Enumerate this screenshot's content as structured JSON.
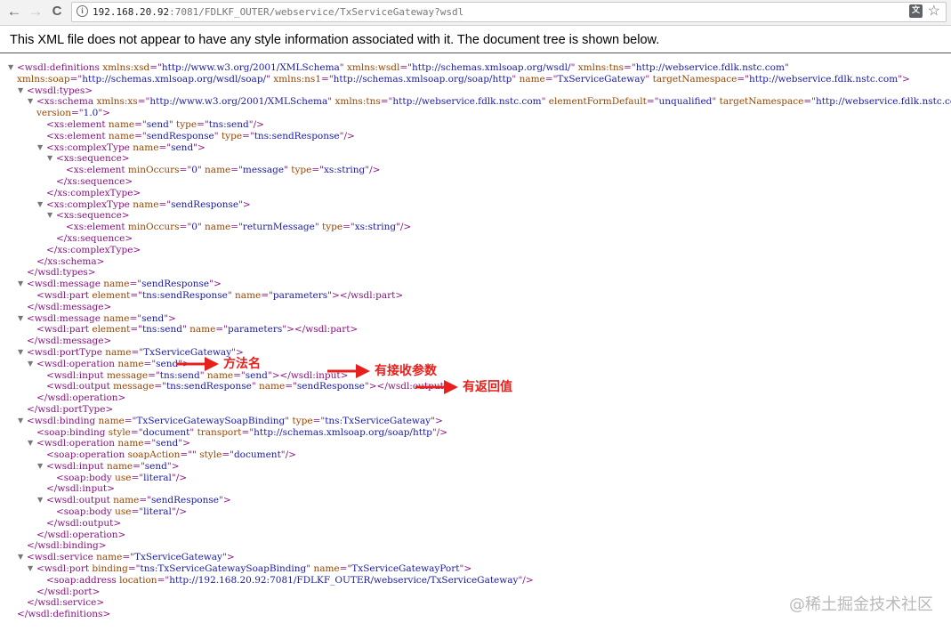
{
  "browser": {
    "url_host": "192.168.20.92",
    "url_rest": ":7081/FDLKF_OUTER/webservice/TxServiceGateway?wsdl",
    "back_glyph": "←",
    "forward_glyph": "→",
    "reload_glyph": "C",
    "info_glyph": "i",
    "translate_glyph": "文",
    "star_glyph": "☆",
    "icons": [
      "back-icon",
      "forward-icon",
      "reload-icon",
      "info-icon",
      "translate-icon",
      "star-icon"
    ]
  },
  "banner": {
    "text": "This XML file does not appear to have any style information associated with it. The document tree is shown below."
  },
  "xml_lines": [
    {
      "fold": true,
      "p": [
        [
          "tag",
          "<wsdl:definitions "
        ],
        [
          "an",
          "xmlns:xsd"
        ],
        [
          "tag",
          "=\""
        ],
        [
          "av",
          "http://www.w3.org/2001/XMLSchema"
        ],
        [
          "tag",
          "\" "
        ],
        [
          "an",
          "xmlns:wsdl"
        ],
        [
          "tag",
          "=\""
        ],
        [
          "av",
          "http://schemas.xmlsoap.org/wsdl/"
        ],
        [
          "tag",
          "\" "
        ],
        [
          "an",
          "xmlns:tns"
        ],
        [
          "tag",
          "=\""
        ],
        [
          "av",
          "http://webservice.fdlk.nstc.com"
        ],
        [
          "tag",
          "\""
        ]
      ]
    },
    {
      "p": [
        [
          "an",
          "xmlns:soap"
        ],
        [
          "tag",
          "=\""
        ],
        [
          "av",
          "http://schemas.xmlsoap.org/wsdl/soap/"
        ],
        [
          "tag",
          "\" "
        ],
        [
          "an",
          "xmlns:ns1"
        ],
        [
          "tag",
          "=\""
        ],
        [
          "av",
          "http://schemas.xmlsoap.org/soap/http"
        ],
        [
          "tag",
          "\" "
        ],
        [
          "an",
          "name"
        ],
        [
          "tag",
          "=\""
        ],
        [
          "av",
          "TxServiceGateway"
        ],
        [
          "tag",
          "\" "
        ],
        [
          "an",
          "targetNamespace"
        ],
        [
          "tag",
          "=\""
        ],
        [
          "av",
          "http://webservice.fdlk.nstc.com"
        ],
        [
          "tag",
          "\">"
        ]
      ]
    },
    {
      "fold": true,
      "p": [
        [
          "tag",
          "<wsdl:types>"
        ]
      ]
    },
    {
      "fold": true,
      "p": [
        [
          "tag",
          "<xs:schema "
        ],
        [
          "an",
          "xmlns:xs"
        ],
        [
          "tag",
          "=\""
        ],
        [
          "av",
          "http://www.w3.org/2001/XMLSchema"
        ],
        [
          "tag",
          "\" "
        ],
        [
          "an",
          "xmlns:tns"
        ],
        [
          "tag",
          "=\""
        ],
        [
          "av",
          "http://webservice.fdlk.nstc.com"
        ],
        [
          "tag",
          "\" "
        ],
        [
          "an",
          "elementFormDefault"
        ],
        [
          "tag",
          "=\""
        ],
        [
          "av",
          "unqualified"
        ],
        [
          "tag",
          "\" "
        ],
        [
          "an",
          "targetNamespace"
        ],
        [
          "tag",
          "=\""
        ],
        [
          "av",
          "http://webservice.fdlk.nstc.com"
        ],
        [
          "tag",
          "\""
        ]
      ]
    },
    {
      "p": [
        [
          "an",
          "version"
        ],
        [
          "tag",
          "=\""
        ],
        [
          "av",
          "1.0"
        ],
        [
          "tag",
          "\">"
        ]
      ]
    },
    {
      "p": [
        [
          "tag",
          "<xs:element "
        ],
        [
          "an",
          "name"
        ],
        [
          "tag",
          "=\""
        ],
        [
          "av",
          "send"
        ],
        [
          "tag",
          "\" "
        ],
        [
          "an",
          "type"
        ],
        [
          "tag",
          "=\""
        ],
        [
          "av",
          "tns:send"
        ],
        [
          "tag",
          "\"/>"
        ]
      ]
    },
    {
      "p": [
        [
          "tag",
          "<xs:element "
        ],
        [
          "an",
          "name"
        ],
        [
          "tag",
          "=\""
        ],
        [
          "av",
          "sendResponse"
        ],
        [
          "tag",
          "\" "
        ],
        [
          "an",
          "type"
        ],
        [
          "tag",
          "=\""
        ],
        [
          "av",
          "tns:sendResponse"
        ],
        [
          "tag",
          "\"/>"
        ]
      ]
    },
    {
      "fold": true,
      "p": [
        [
          "tag",
          "<xs:complexType "
        ],
        [
          "an",
          "name"
        ],
        [
          "tag",
          "=\""
        ],
        [
          "av",
          "send"
        ],
        [
          "tag",
          "\">"
        ]
      ]
    },
    {
      "fold": true,
      "p": [
        [
          "tag",
          "<xs:sequence>"
        ]
      ]
    },
    {
      "p": [
        [
          "tag",
          "<xs:element "
        ],
        [
          "an",
          "minOccurs"
        ],
        [
          "tag",
          "=\""
        ],
        [
          "av",
          "0"
        ],
        [
          "tag",
          "\" "
        ],
        [
          "an",
          "name"
        ],
        [
          "tag",
          "=\""
        ],
        [
          "av",
          "message"
        ],
        [
          "tag",
          "\" "
        ],
        [
          "an",
          "type"
        ],
        [
          "tag",
          "=\""
        ],
        [
          "av",
          "xs:string"
        ],
        [
          "tag",
          "\"/>"
        ]
      ]
    },
    {
      "p": [
        [
          "tag",
          "</xs:sequence>"
        ]
      ]
    },
    {
      "p": [
        [
          "tag",
          "</xs:complexType>"
        ]
      ]
    },
    {
      "fold": true,
      "p": [
        [
          "tag",
          "<xs:complexType "
        ],
        [
          "an",
          "name"
        ],
        [
          "tag",
          "=\""
        ],
        [
          "av",
          "sendResponse"
        ],
        [
          "tag",
          "\">"
        ]
      ]
    },
    {
      "fold": true,
      "p": [
        [
          "tag",
          "<xs:sequence>"
        ]
      ]
    },
    {
      "p": [
        [
          "tag",
          "<xs:element "
        ],
        [
          "an",
          "minOccurs"
        ],
        [
          "tag",
          "=\""
        ],
        [
          "av",
          "0"
        ],
        [
          "tag",
          "\" "
        ],
        [
          "an",
          "name"
        ],
        [
          "tag",
          "=\""
        ],
        [
          "av",
          "returnMessage"
        ],
        [
          "tag",
          "\" "
        ],
        [
          "an",
          "type"
        ],
        [
          "tag",
          "=\""
        ],
        [
          "av",
          "xs:string"
        ],
        [
          "tag",
          "\"/>"
        ]
      ]
    },
    {
      "p": [
        [
          "tag",
          "</xs:sequence>"
        ]
      ]
    },
    {
      "p": [
        [
          "tag",
          "</xs:complexType>"
        ]
      ]
    },
    {
      "p": [
        [
          "tag",
          "</xs:schema>"
        ]
      ]
    },
    {
      "p": [
        [
          "tag",
          "</wsdl:types>"
        ]
      ]
    },
    {
      "fold": true,
      "p": [
        [
          "tag",
          "<wsdl:message "
        ],
        [
          "an",
          "name"
        ],
        [
          "tag",
          "=\""
        ],
        [
          "av",
          "sendResponse"
        ],
        [
          "tag",
          "\">"
        ]
      ]
    },
    {
      "p": [
        [
          "tag",
          "<wsdl:part "
        ],
        [
          "an",
          "element"
        ],
        [
          "tag",
          "=\""
        ],
        [
          "av",
          "tns:sendResponse"
        ],
        [
          "tag",
          "\" "
        ],
        [
          "an",
          "name"
        ],
        [
          "tag",
          "=\""
        ],
        [
          "av",
          "parameters"
        ],
        [
          "tag",
          "\"></wsdl:part>"
        ]
      ]
    },
    {
      "p": [
        [
          "tag",
          "</wsdl:message>"
        ]
      ]
    },
    {
      "fold": true,
      "p": [
        [
          "tag",
          "<wsdl:message "
        ],
        [
          "an",
          "name"
        ],
        [
          "tag",
          "=\""
        ],
        [
          "av",
          "send"
        ],
        [
          "tag",
          "\">"
        ]
      ]
    },
    {
      "p": [
        [
          "tag",
          "<wsdl:part "
        ],
        [
          "an",
          "element"
        ],
        [
          "tag",
          "=\""
        ],
        [
          "av",
          "tns:send"
        ],
        [
          "tag",
          "\" "
        ],
        [
          "an",
          "name"
        ],
        [
          "tag",
          "=\""
        ],
        [
          "av",
          "parameters"
        ],
        [
          "tag",
          "\"></wsdl:part>"
        ]
      ]
    },
    {
      "p": [
        [
          "tag",
          "</wsdl:message>"
        ]
      ]
    },
    {
      "fold": true,
      "p": [
        [
          "tag",
          "<wsdl:portType "
        ],
        [
          "an",
          "name"
        ],
        [
          "tag",
          "=\""
        ],
        [
          "av",
          "TxServiceGateway"
        ],
        [
          "tag",
          "\">"
        ]
      ]
    },
    {
      "fold": true,
      "p": [
        [
          "tag",
          "<wsdl:operation "
        ],
        [
          "an",
          "name"
        ],
        [
          "tag",
          "=\""
        ],
        [
          "av",
          "send"
        ],
        [
          "tag",
          "\">"
        ]
      ]
    },
    {
      "p": [
        [
          "tag",
          "<wsdl:input "
        ],
        [
          "an",
          "message"
        ],
        [
          "tag",
          "=\""
        ],
        [
          "av",
          "tns:send"
        ],
        [
          "tag",
          "\" "
        ],
        [
          "an",
          "name"
        ],
        [
          "tag",
          "=\""
        ],
        [
          "av",
          "send"
        ],
        [
          "tag",
          "\"></wsdl:input>"
        ]
      ]
    },
    {
      "p": [
        [
          "tag",
          "<wsdl:output "
        ],
        [
          "an",
          "message"
        ],
        [
          "tag",
          "=\""
        ],
        [
          "av",
          "tns:sendResponse"
        ],
        [
          "tag",
          "\" "
        ],
        [
          "an",
          "name"
        ],
        [
          "tag",
          "=\""
        ],
        [
          "av",
          "sendResponse"
        ],
        [
          "tag",
          "\"></wsdl:output>"
        ]
      ]
    },
    {
      "p": [
        [
          "tag",
          "</wsdl:operation>"
        ]
      ]
    },
    {
      "p": [
        [
          "tag",
          "</wsdl:portType>"
        ]
      ]
    },
    {
      "fold": true,
      "p": [
        [
          "tag",
          "<wsdl:binding "
        ],
        [
          "an",
          "name"
        ],
        [
          "tag",
          "=\""
        ],
        [
          "av",
          "TxServiceGatewaySoapBinding"
        ],
        [
          "tag",
          "\" "
        ],
        [
          "an",
          "type"
        ],
        [
          "tag",
          "=\""
        ],
        [
          "av",
          "tns:TxServiceGateway"
        ],
        [
          "tag",
          "\">"
        ]
      ]
    },
    {
      "p": [
        [
          "tag",
          "<soap:binding "
        ],
        [
          "an",
          "style"
        ],
        [
          "tag",
          "=\""
        ],
        [
          "av",
          "document"
        ],
        [
          "tag",
          "\" "
        ],
        [
          "an",
          "transport"
        ],
        [
          "tag",
          "=\""
        ],
        [
          "av",
          "http://schemas.xmlsoap.org/soap/http"
        ],
        [
          "tag",
          "\"/>"
        ]
      ]
    },
    {
      "fold": true,
      "p": [
        [
          "tag",
          "<wsdl:operation "
        ],
        [
          "an",
          "name"
        ],
        [
          "tag",
          "=\""
        ],
        [
          "av",
          "send"
        ],
        [
          "tag",
          "\">"
        ]
      ]
    },
    {
      "p": [
        [
          "tag",
          "<soap:operation "
        ],
        [
          "an",
          "soapAction"
        ],
        [
          "tag",
          "=\"\" "
        ],
        [
          "an",
          "style"
        ],
        [
          "tag",
          "=\""
        ],
        [
          "av",
          "document"
        ],
        [
          "tag",
          "\"/>"
        ]
      ]
    },
    {
      "fold": true,
      "p": [
        [
          "tag",
          "<wsdl:input "
        ],
        [
          "an",
          "name"
        ],
        [
          "tag",
          "=\""
        ],
        [
          "av",
          "send"
        ],
        [
          "tag",
          "\">"
        ]
      ]
    },
    {
      "p": [
        [
          "tag",
          "<soap:body "
        ],
        [
          "an",
          "use"
        ],
        [
          "tag",
          "=\""
        ],
        [
          "av",
          "literal"
        ],
        [
          "tag",
          "\"/>"
        ]
      ]
    },
    {
      "p": [
        [
          "tag",
          "</wsdl:input>"
        ]
      ]
    },
    {
      "fold": true,
      "p": [
        [
          "tag",
          "<wsdl:output "
        ],
        [
          "an",
          "name"
        ],
        [
          "tag",
          "=\""
        ],
        [
          "av",
          "sendResponse"
        ],
        [
          "tag",
          "\">"
        ]
      ]
    },
    {
      "p": [
        [
          "tag",
          "<soap:body "
        ],
        [
          "an",
          "use"
        ],
        [
          "tag",
          "=\""
        ],
        [
          "av",
          "literal"
        ],
        [
          "tag",
          "\"/>"
        ]
      ]
    },
    {
      "p": [
        [
          "tag",
          "</wsdl:output>"
        ]
      ]
    },
    {
      "p": [
        [
          "tag",
          "</wsdl:operation>"
        ]
      ]
    },
    {
      "p": [
        [
          "tag",
          "</wsdl:binding>"
        ]
      ]
    },
    {
      "fold": true,
      "p": [
        [
          "tag",
          "<wsdl:service "
        ],
        [
          "an",
          "name"
        ],
        [
          "tag",
          "=\""
        ],
        [
          "av",
          "TxServiceGateway"
        ],
        [
          "tag",
          "\">"
        ]
      ]
    },
    {
      "fold": true,
      "p": [
        [
          "tag",
          "<wsdl:port "
        ],
        [
          "an",
          "binding"
        ],
        [
          "tag",
          "=\""
        ],
        [
          "av",
          "tns:TxServiceGatewaySoapBinding"
        ],
        [
          "tag",
          "\" "
        ],
        [
          "an",
          "name"
        ],
        [
          "tag",
          "=\""
        ],
        [
          "av",
          "TxServiceGatewayPort"
        ],
        [
          "tag",
          "\">"
        ]
      ]
    },
    {
      "p": [
        [
          "tag",
          "<soap:address "
        ],
        [
          "an",
          "location"
        ],
        [
          "tag",
          "=\""
        ],
        [
          "av",
          "http://192.168.20.92:7081/FDLKF_OUTER/webservice/TxServiceGateway"
        ],
        [
          "tag",
          "\"/>"
        ]
      ]
    },
    {
      "p": [
        [
          "tag",
          "</wsdl:port>"
        ]
      ]
    },
    {
      "p": [
        [
          "tag",
          "</wsdl:service>"
        ]
      ]
    },
    {
      "p": [
        [
          "tag",
          "</wsdl:definitions>"
        ]
      ]
    }
  ],
  "annotations": {
    "method_name": "方法名",
    "has_params": "有接收参数",
    "has_return": "有返回值",
    "color": "#e8201d"
  },
  "watermark": "@稀土掘金技术社区",
  "colors": {
    "tag": "#881280",
    "attr_name": "#994500",
    "attr_value": "#1a1aa6"
  }
}
